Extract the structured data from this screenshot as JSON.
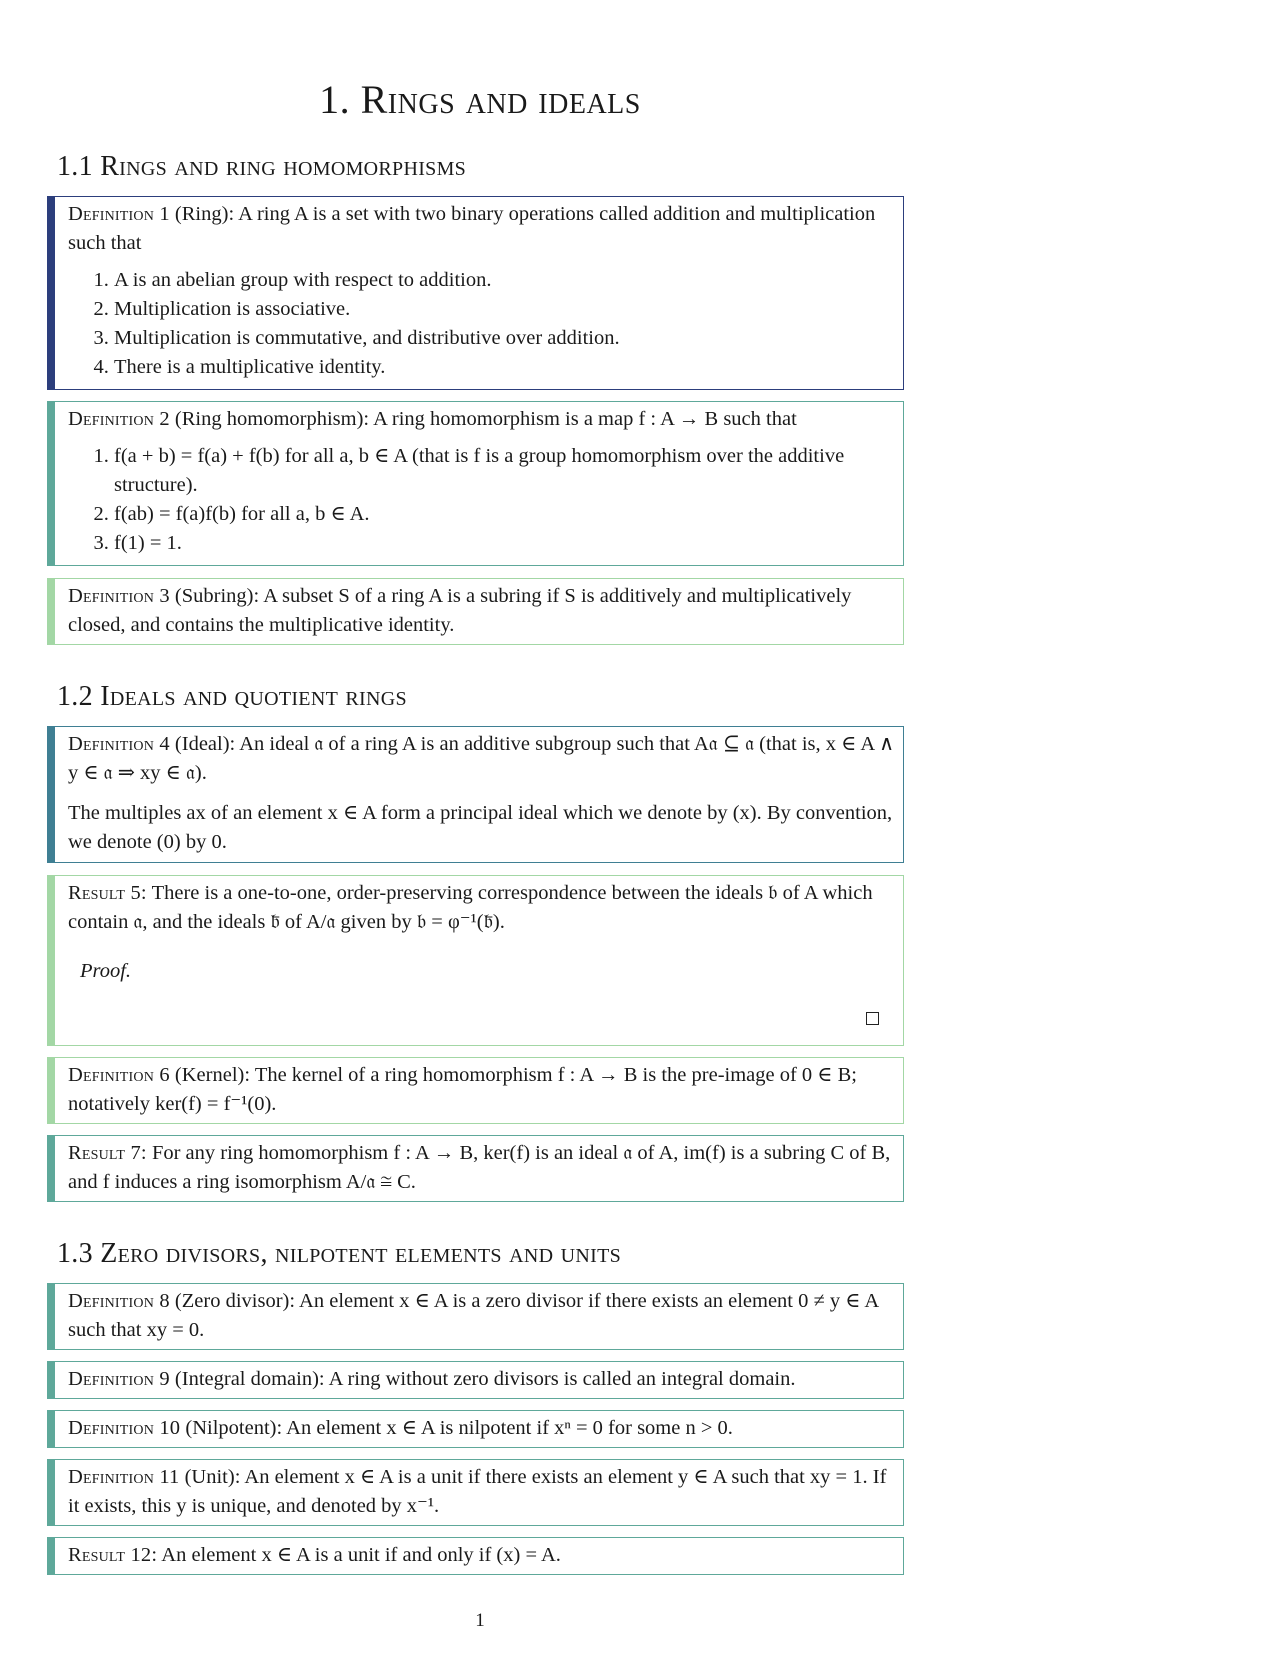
{
  "chapter_title": "1. Rings and ideals",
  "sections": [
    {
      "title": "1.1 Rings and ring homomorphisms"
    },
    {
      "title": "1.2 Ideals and quotient rings"
    },
    {
      "title": "1.3 Zero divisors, nilpotent elements and units"
    }
  ],
  "colors": {
    "box_definition_1": "#2c3e7c",
    "box_definition_2": "#5ea89a",
    "box_definition_3": "#a3d7a5",
    "box_definition_4": "#3f7f93",
    "box_result_5": "#a3d7a5",
    "box_definition_6": "#a3d7a5",
    "box_result_7": "#5ea89a",
    "box_definition_8": "#5ea89a",
    "box_definition_9": "#5ea89a",
    "box_definition_10": "#5ea89a",
    "box_definition_11": "#5ea89a",
    "box_result_12": "#5ea89a"
  },
  "blocks": {
    "def1": {
      "label": "Definition 1",
      "name": "(Ring):",
      "intro": "A ring A is a set with two binary operations called addition and multiplication such that",
      "items": [
        "A is an abelian group with respect to addition.",
        "Multiplication is associative.",
        "Multiplication is commutative, and distributive over addition.",
        "There is a multiplicative identity."
      ]
    },
    "def2": {
      "label": "Definition 2",
      "name": "(Ring homomorphism):",
      "intro": "A ring homomorphism is a map f : A → B such that",
      "items": [
        "f(a + b) = f(a) + f(b) for all a, b ∈ A (that is f is a group homomorphism over the additive structure).",
        "f(ab) = f(a)f(b) for all a, b ∈ A.",
        "f(1) = 1."
      ]
    },
    "def3": {
      "label": "Definition 3",
      "name": "(Subring):",
      "text": "A subset S of a ring A is a subring if S is additively and multiplicatively closed, and contains the multiplicative identity."
    },
    "def4": {
      "label": "Definition 4",
      "name": "(Ideal):",
      "text": "An ideal 𝔞 of a ring A is an additive subgroup such that A𝔞 ⊆ 𝔞 (that is, x ∈ A ∧ y ∈ 𝔞 ⇒ xy ∈ 𝔞).",
      "text2": "The multiples ax of an element x ∈ A form a principal ideal which we denote by (x). By convention, we denote (0) by 0."
    },
    "res5": {
      "label": "Result 5:",
      "text": "There is a one-to-one, order-preserving correspondence between the ideals 𝔟 of A which contain 𝔞, and the ideals 𝔟̄ of A/𝔞 given by 𝔟 = φ⁻¹(𝔟̄).",
      "proof": "Proof."
    },
    "def6": {
      "label": "Definition 6",
      "name": "(Kernel):",
      "text": "The kernel of a ring homomorphism f : A → B is the pre-image of 0 ∈ B; notatively ker(f) = f⁻¹(0)."
    },
    "res7": {
      "label": "Result 7:",
      "text": "For any ring homomorphism f : A → B, ker(f) is an ideal 𝔞 of A, im(f) is a subring C of B, and f induces a ring isomorphism A/𝔞 ≅ C."
    },
    "def8": {
      "label": "Definition 8",
      "name": "(Zero divisor):",
      "text": "An element x ∈ A is a zero divisor if there exists an element 0 ≠ y ∈ A such that xy = 0."
    },
    "def9": {
      "label": "Definition 9",
      "name": "(Integral domain):",
      "text": "A ring without zero divisors is called an integral domain."
    },
    "def10": {
      "label": "Definition 10",
      "name": "(Nilpotent):",
      "text": "An element x ∈ A is nilpotent if xⁿ = 0 for some n > 0."
    },
    "def11": {
      "label": "Definition 11",
      "name": "(Unit):",
      "text": "An element x ∈ A is a unit if there exists an element y ∈ A such that xy = 1. If it exists, this y is unique, and denoted by x⁻¹."
    },
    "res12": {
      "label": "Result 12:",
      "text": "An element x ∈ A is a unit if and only if (x) = A."
    }
  },
  "page_number": "1"
}
